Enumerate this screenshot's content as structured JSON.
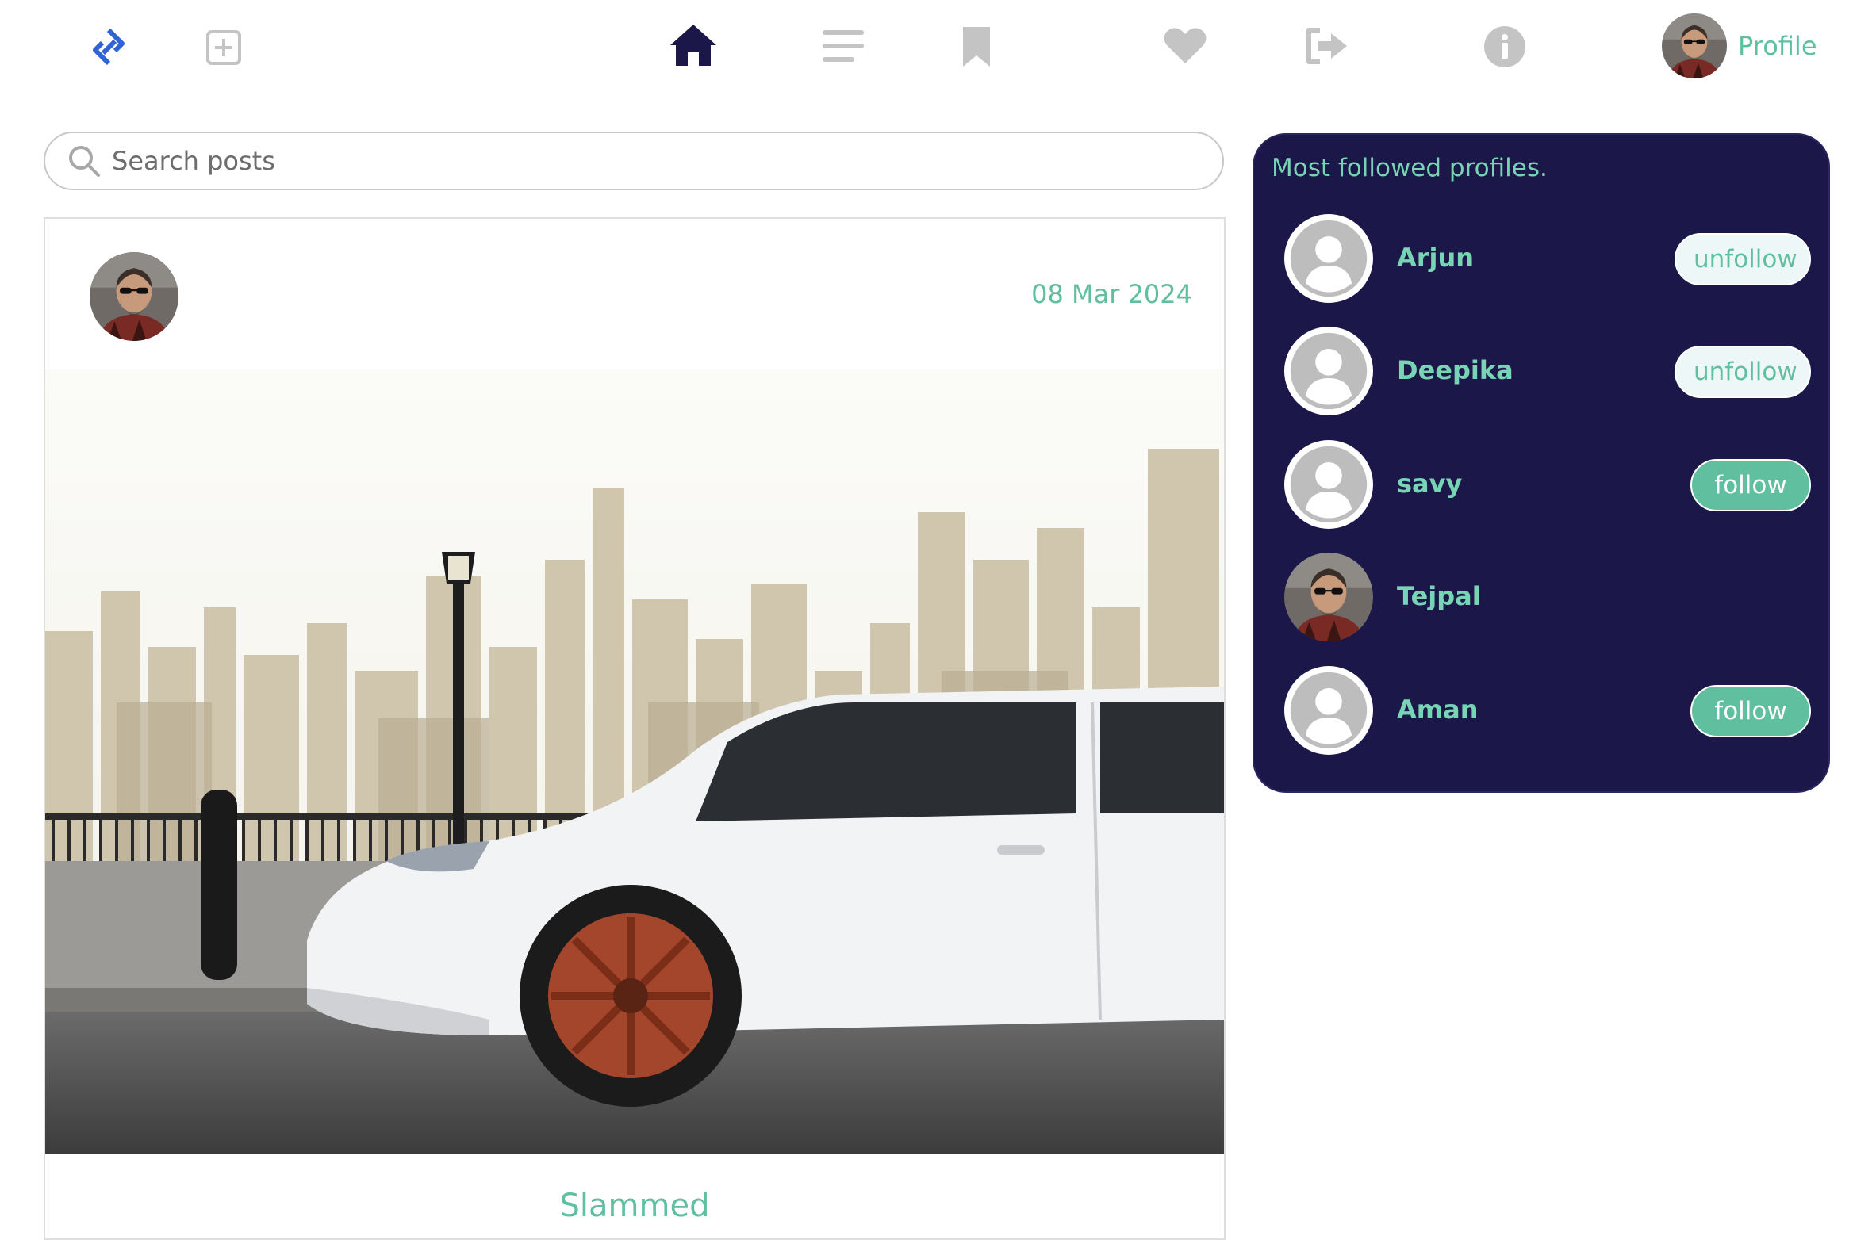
{
  "nav": {
    "icons": [
      "app-logo-icon",
      "add-post-icon",
      "home-icon",
      "feed-list-icon",
      "bookmark-icon",
      "heart-icon",
      "logout-icon",
      "info-icon"
    ],
    "profile_label": "Profile",
    "active_color": "#1b1748",
    "inactive_color": "#c4c4c4",
    "logo_color": "#2f63d6"
  },
  "search": {
    "placeholder": "Search posts"
  },
  "post": {
    "date": "08 Mar 2024",
    "title": "Slammed"
  },
  "followed": {
    "title": "Most followed profiles.",
    "profiles": [
      {
        "name": "Arjun",
        "action": "unfollow",
        "avatar": "default"
      },
      {
        "name": "Deepika",
        "action": "unfollow",
        "avatar": "default"
      },
      {
        "name": "savy",
        "action": "follow",
        "avatar": "default"
      },
      {
        "name": "Tejpal",
        "action": "",
        "avatar": "photo"
      },
      {
        "name": "Aman",
        "action": "follow",
        "avatar": "default"
      }
    ]
  },
  "colors": {
    "accent": "#5fbf9f",
    "panel_bg": "#1b1748"
  }
}
